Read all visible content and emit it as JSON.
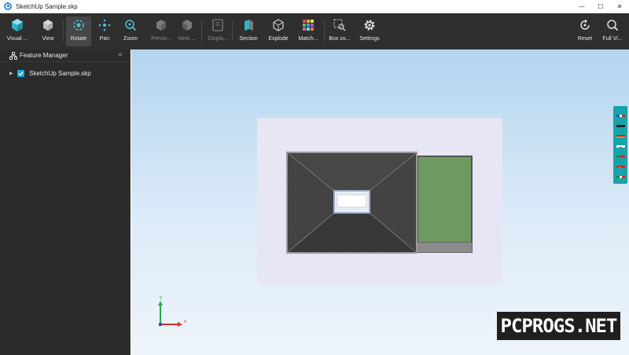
{
  "window": {
    "title": "SketchUp Sample.skp",
    "controls": [
      "—",
      "☐",
      "✕"
    ]
  },
  "toolbar": {
    "left": [
      {
        "label": "Visual ...",
        "icon": "cube-icon",
        "state": "normal"
      },
      {
        "label": "View",
        "icon": "view-cube-icon",
        "state": "normal"
      },
      {
        "label": "Rotate",
        "icon": "rotate-icon",
        "state": "active"
      },
      {
        "label": "Pan",
        "icon": "pan-icon",
        "state": "normal"
      },
      {
        "label": "Zoom",
        "icon": "zoom-icon",
        "state": "normal"
      },
      {
        "label": "Previo...",
        "icon": "previous-view-icon",
        "state": "disabled"
      },
      {
        "label": "Next ...",
        "icon": "next-view-icon",
        "state": "disabled"
      },
      {
        "label": "Displa...",
        "icon": "display-icon",
        "state": "disabled"
      },
      {
        "label": "Section",
        "icon": "section-icon",
        "state": "normal"
      },
      {
        "label": "Explode",
        "icon": "explode-icon",
        "state": "normal"
      },
      {
        "label": "Match...",
        "icon": "match-color-icon",
        "state": "normal"
      },
      {
        "label": "Box zo...",
        "icon": "box-zoom-icon",
        "state": "normal"
      },
      {
        "label": "Settings",
        "icon": "gear-icon",
        "state": "normal"
      }
    ],
    "right": [
      {
        "label": "Reset",
        "icon": "reset-icon",
        "state": "normal"
      },
      {
        "label": "Full Vi...",
        "icon": "full-view-icon",
        "state": "normal"
      }
    ]
  },
  "sidebar": {
    "title": "Feature Manager",
    "collapse_glyph": "«",
    "tree": [
      {
        "label": "SketchUp Sample.skp",
        "checked": true,
        "expanded": false
      }
    ]
  },
  "viewport": {
    "axis_labels": {
      "y": "y",
      "x": "x"
    },
    "languages": [
      "fr-flag-icon",
      "de-flag-icon",
      "es-flag-icon",
      "jp-flag-icon",
      "pt-flag-icon",
      "tr-flag-icon",
      "it-flag-icon"
    ]
  },
  "watermark": {
    "text": "PCPROGS.NET"
  },
  "colors": {
    "toolbar_bg": "#2f2f2f",
    "sidebar_bg": "#2b2b2b",
    "accent": "#19a8d8",
    "lang_bar": "#17a4a8",
    "lawn": "#6e9a5f"
  }
}
